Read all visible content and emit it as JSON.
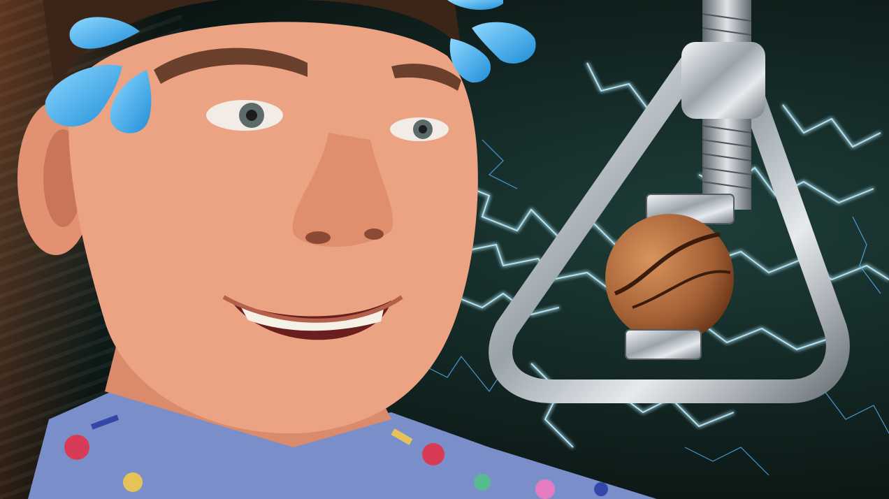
{
  "scene": {
    "subject": "smiling-man",
    "object": "triangle-nut-cracker",
    "effect": "electric-lightning",
    "decorations": [
      "sweat-drop-emoji",
      "sweat-drop-emoji"
    ]
  },
  "colors": {
    "background": "#122522",
    "lightning": "#7fd8ff",
    "metal": "#c9cfd4",
    "nut": "#b06a3a",
    "skin": "#e9a07f",
    "sweat": "#38b2ef"
  }
}
